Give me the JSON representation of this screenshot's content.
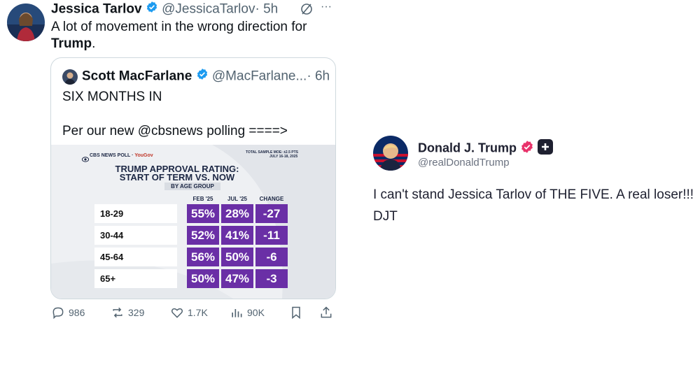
{
  "tweet": {
    "name": "Jessica Tarlov",
    "handle": "@JessicaTarlov",
    "time": "· 5h",
    "text_line1": "A lot of movement in the wrong direction for",
    "text_bold": "Trump",
    "text_end": ".",
    "more": "···"
  },
  "quote": {
    "name": "Scott MacFarlane",
    "handle": "@MacFarlane...",
    "time": "· 6h",
    "line1": "SIX MONTHS IN",
    "line2": "Per our new @cbsnews polling ====>"
  },
  "poll": {
    "brand": "CBS NEWS POLL",
    "partner": "YouGov",
    "sample": "TOTAL SAMPLE MOE: ±2.5 PTS",
    "dates": "JULY 16-18, 2025",
    "title1": "TRUMP APPROVAL RATING:",
    "title2": "START OF TERM VS. NOW",
    "subtitle": "BY AGE GROUP",
    "headers": [
      "FEB '25",
      "JUL '25",
      "CHANGE"
    ],
    "rows": [
      {
        "label": "18-29",
        "feb": "55%",
        "jul": "28%",
        "change": "-27"
      },
      {
        "label": "30-44",
        "feb": "52%",
        "jul": "41%",
        "change": "-11"
      },
      {
        "label": "45-64",
        "feb": "56%",
        "jul": "50%",
        "change": "-6"
      },
      {
        "label": "65+",
        "feb": "50%",
        "jul": "47%",
        "change": "-3"
      }
    ]
  },
  "actions": {
    "replies": "986",
    "reposts": "329",
    "likes": "1.7K",
    "views": "90K"
  },
  "truth": {
    "name": "Donald J. Trump",
    "handle": "@realDonaldTrump",
    "text": "I can't stand Jessica Tarlov of THE FIVE. A real loser!!! DJT"
  },
  "colors": {
    "verified_blue": "#1d9bf0",
    "truth_badge": "#e8326a",
    "poll_purple": "#6a2fa6"
  }
}
